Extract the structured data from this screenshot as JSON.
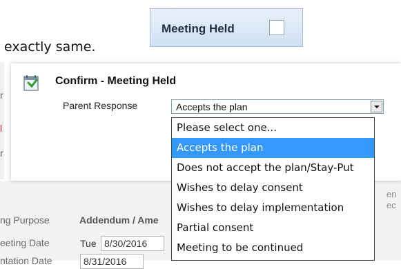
{
  "doc": {
    "text": "exactly same."
  },
  "chip": {
    "label": "Meeting Held"
  },
  "dialog": {
    "title": "Confirm - Meeting Held",
    "field_label": "Parent Response",
    "selected_value": "Accepts the plan",
    "options": [
      "Please select one...",
      "Accepts the plan",
      "Does not accept the plan/Stay-Put",
      "Wishes to delay consent",
      "Wishes to delay implementation",
      "Partial consent",
      "Meeting to be continued"
    ],
    "selected_index": 1
  },
  "background_form": {
    "purpose_label": "ng Purpose",
    "purpose_value": "Addendum / Ame",
    "meeting_date_label": "eeting Date",
    "meeting_day": "Tue",
    "meeting_date_value": "8/30/2016",
    "impl_date_label": "ntation Date",
    "impl_date_value": "8/31/2016",
    "right_edge_1": "en",
    "right_edge_2": "ec"
  },
  "colors": {
    "selected_option": "#3399ff",
    "chip_bg": "#d9e7f6"
  }
}
